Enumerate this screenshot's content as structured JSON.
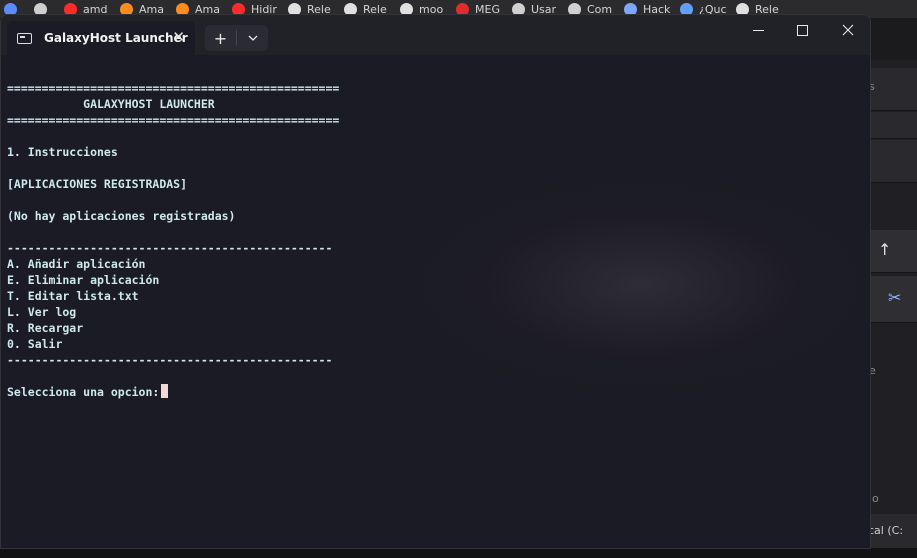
{
  "bookmarks": [
    {
      "label": "",
      "icon": "globe-icon",
      "color": "#5b8cff"
    },
    {
      "label": "",
      "icon": "gamepad-icon",
      "color": "#cfcfcf"
    },
    {
      "label": "amd",
      "icon": "youtube-icon",
      "color": "#ff2a2a"
    },
    {
      "label": "Ama",
      "icon": "amazon-icon",
      "color": "#ff8a1f"
    },
    {
      "label": "Ama",
      "icon": "amazon-icon",
      "color": "#ff8a1f"
    },
    {
      "label": "Hidir",
      "icon": "youtube-icon",
      "color": "#ff2a2a"
    },
    {
      "label": "Rele",
      "icon": "github-icon",
      "color": "#e0e0e0"
    },
    {
      "label": "Rele",
      "icon": "github-icon",
      "color": "#e0e0e0"
    },
    {
      "label": "moo",
      "icon": "github-icon",
      "color": "#e0e0e0"
    },
    {
      "label": "MEG",
      "icon": "mega-icon",
      "color": "#e32b2b"
    },
    {
      "label": "Usar",
      "icon": "openai-icon",
      "color": "#d0d0d0"
    },
    {
      "label": "Com",
      "icon": "openai-icon",
      "color": "#d0d0d0"
    },
    {
      "label": "Hack",
      "icon": "sparkle-icon",
      "color": "#7ea6ff"
    },
    {
      "label": "¿Quc",
      "icon": "gemini-icon",
      "color": "#5fa0ff"
    },
    {
      "label": "Rele",
      "icon": "github-icon",
      "color": "#e0e0e0"
    }
  ],
  "window": {
    "tab_title": "GalaxyHost Launcher",
    "tab_close": "✕",
    "new_tab": "+",
    "dropdown": "⌄",
    "minimize": "—",
    "maximize": "☐",
    "close": "✕"
  },
  "terminal": {
    "lines": [
      "================================================",
      "           GALAXYHOST LAUNCHER",
      "================================================",
      "",
      "1. Instrucciones",
      "",
      "[APLICACIONES REGISTRADAS]",
      "",
      "(No hay aplicaciones registradas)",
      "",
      "-----------------------------------------------",
      "A. Añadir aplicación",
      "E. Eliminar aplicación",
      "T. Editar lista.txt",
      "L. Ver log",
      "R. Recargar",
      "0. Salir",
      "-----------------------------------------------",
      ""
    ],
    "prompt": "Selecciona una opcion:"
  },
  "background_app": {
    "fragments": [
      "s",
      "e",
      "o",
      "cal (C:"
    ],
    "arrow_up": "↑",
    "scissors": "✂"
  }
}
